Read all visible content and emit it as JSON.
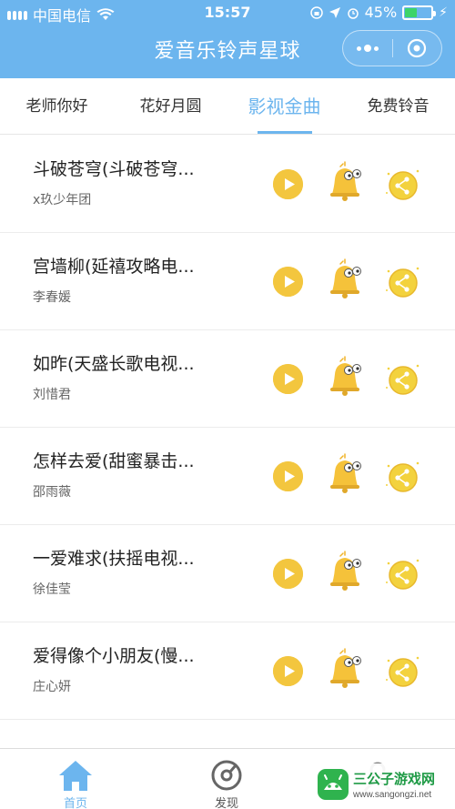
{
  "status_bar": {
    "carrier": "中国电信",
    "time": "15:57",
    "battery": "45%",
    "battery_level": 0.45
  },
  "header": {
    "title": "爱音乐铃声星球",
    "more_icon": "more-dots-icon",
    "close_icon": "close-circle-icon"
  },
  "tabs": [
    {
      "label": "老师你好",
      "active": false
    },
    {
      "label": "花好月圆",
      "active": false
    },
    {
      "label": "影视金曲",
      "active": true
    },
    {
      "label": "免费铃音",
      "active": false
    }
  ],
  "songs": [
    {
      "title": "斗破苍穹(斗破苍穹...",
      "artist": "x玖少年团"
    },
    {
      "title": "宫墙柳(延禧攻略电...",
      "artist": "李春媛"
    },
    {
      "title": "如昨(天盛长歌电视...",
      "artist": "刘惜君"
    },
    {
      "title": "怎样去爱(甜蜜暴击...",
      "artist": "邵雨薇"
    },
    {
      "title": "一爱难求(扶摇电视...",
      "artist": "徐佳莹"
    },
    {
      "title": "爱得像个小朋友(慢...",
      "artist": "庄心妍"
    }
  ],
  "tabbar": [
    {
      "label": "首页",
      "icon": "home-icon",
      "active": true
    },
    {
      "label": "发现",
      "icon": "discover-icon",
      "active": false
    },
    {
      "label": "",
      "icon": "profile-icon",
      "active": false
    }
  ],
  "watermark": {
    "name": "三公子游戏网",
    "url": "www.sangongzi.net"
  },
  "colors": {
    "accent": "#6cb5ee",
    "play": "#f3c63e",
    "bell": "#f5c23a",
    "share": "#f3d23e"
  }
}
